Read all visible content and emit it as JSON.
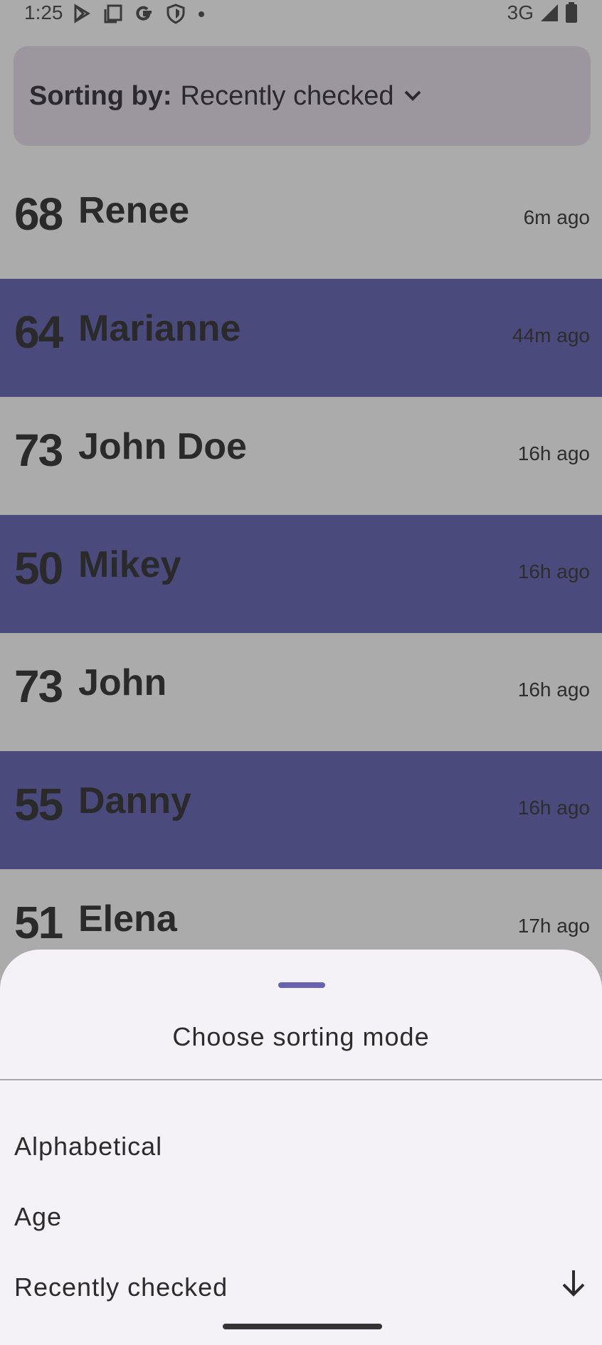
{
  "status_bar": {
    "time": "1:25",
    "network": "3G",
    "left_icons": [
      "play-store-icon",
      "screen-icon",
      "google-icon",
      "shield-icon",
      "dot-icon"
    ],
    "right_icons": [
      "signal-icon",
      "battery-icon"
    ]
  },
  "header": {
    "prefix": "Sorting by:",
    "value": "Recently checked",
    "icon": "chevron-down-icon"
  },
  "people": [
    {
      "age": "68",
      "name": "Renee",
      "ago": "6m ago"
    },
    {
      "age": "64",
      "name": "Marianne",
      "ago": "44m ago"
    },
    {
      "age": "73",
      "name": "John Doe",
      "ago": "16h ago"
    },
    {
      "age": "50",
      "name": "Mikey",
      "ago": "16h ago"
    },
    {
      "age": "73",
      "name": "John",
      "ago": "16h ago"
    },
    {
      "age": "55",
      "name": "Danny",
      "ago": "16h ago"
    },
    {
      "age": "51",
      "name": "Elena",
      "ago": "17h ago"
    }
  ],
  "sheet": {
    "title": "Choose sorting mode",
    "options": [
      {
        "label": "Alphabetical"
      },
      {
        "label": "Age"
      },
      {
        "label": "Recently checked",
        "icon": "arrow-down-icon"
      }
    ]
  },
  "colors": {
    "alt_row": "#4b4a7d",
    "scrim_bg": "#ababab",
    "sheet_bg": "#f4f1f7",
    "handle": "#6a62b0"
  }
}
